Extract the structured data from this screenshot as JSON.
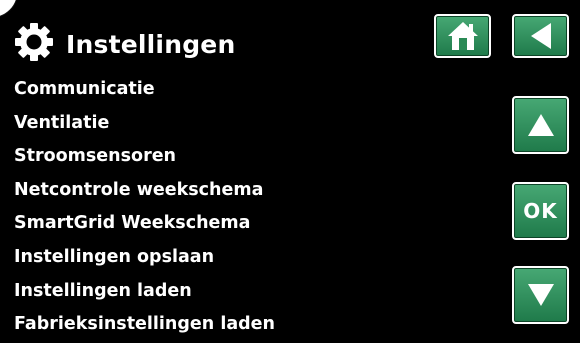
{
  "header": {
    "title": "Instellingen",
    "icon": "gear-icon"
  },
  "menu": {
    "items": [
      {
        "label": "Communicatie"
      },
      {
        "label": "Ventilatie"
      },
      {
        "label": "Stroomsensoren"
      },
      {
        "label": "Netcontrole weekschema"
      },
      {
        "label": "SmartGrid Weekschema"
      },
      {
        "label": "Instellingen opslaan"
      },
      {
        "label": "Instellingen laden"
      },
      {
        "label": "Fabrieksinstellingen laden"
      }
    ]
  },
  "buttons": {
    "home_icon": "home-icon",
    "back_icon": "back-arrow-icon",
    "up_icon": "up-arrow-icon",
    "ok_label": "OK",
    "down_icon": "down-arrow-icon"
  },
  "colors": {
    "background": "#000000",
    "button_green": "#2e8b57",
    "text": "#ffffff"
  }
}
